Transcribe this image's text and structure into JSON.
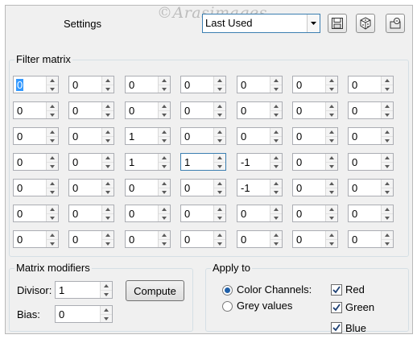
{
  "header": {
    "settings_label": "Settings",
    "watermark": "©Arasimages",
    "preset_value": "Last Used"
  },
  "filter_matrix": {
    "title": "Filter matrix",
    "rows": [
      [
        "0",
        "0",
        "0",
        "0",
        "0",
        "0",
        "0"
      ],
      [
        "0",
        "0",
        "0",
        "0",
        "0",
        "0",
        "0"
      ],
      [
        "0",
        "0",
        "1",
        "0",
        "0",
        "0",
        "0"
      ],
      [
        "0",
        "0",
        "1",
        "1",
        "-1",
        "0",
        "0"
      ],
      [
        "0",
        "0",
        "0",
        "0",
        "-1",
        "0",
        "0"
      ],
      [
        "0",
        "0",
        "0",
        "0",
        "0",
        "0",
        "0"
      ],
      [
        "0",
        "0",
        "0",
        "0",
        "0",
        "0",
        "0"
      ]
    ]
  },
  "modifiers": {
    "title": "Matrix modifiers",
    "divisor_label": "Divisor:",
    "divisor_value": "1",
    "bias_label": "Bias:",
    "bias_value": "0",
    "compute_label": "Compute"
  },
  "apply_to": {
    "title": "Apply to",
    "color_channels_label": "Color Channels:",
    "grey_values_label": "Grey values",
    "mode_selected": "Color Channels:",
    "red_label": "Red",
    "green_label": "Green",
    "blue_label": "Blue",
    "red_checked": true,
    "green_checked": true,
    "blue_checked": true
  },
  "colors": {
    "dialog_bg": "#f0f0f0",
    "focus_border": "#3c7fb1",
    "selection": "#3399ff",
    "radio_dot": "#1f5fa8"
  },
  "icons": {
    "dropdown": "chevron-down-icon",
    "save": "save-icon",
    "randomize": "dice-icon",
    "reset": "reset-icon",
    "spin_up": "arrow-up-icon",
    "spin_down": "arrow-down-icon",
    "check": "checkmark-icon"
  }
}
